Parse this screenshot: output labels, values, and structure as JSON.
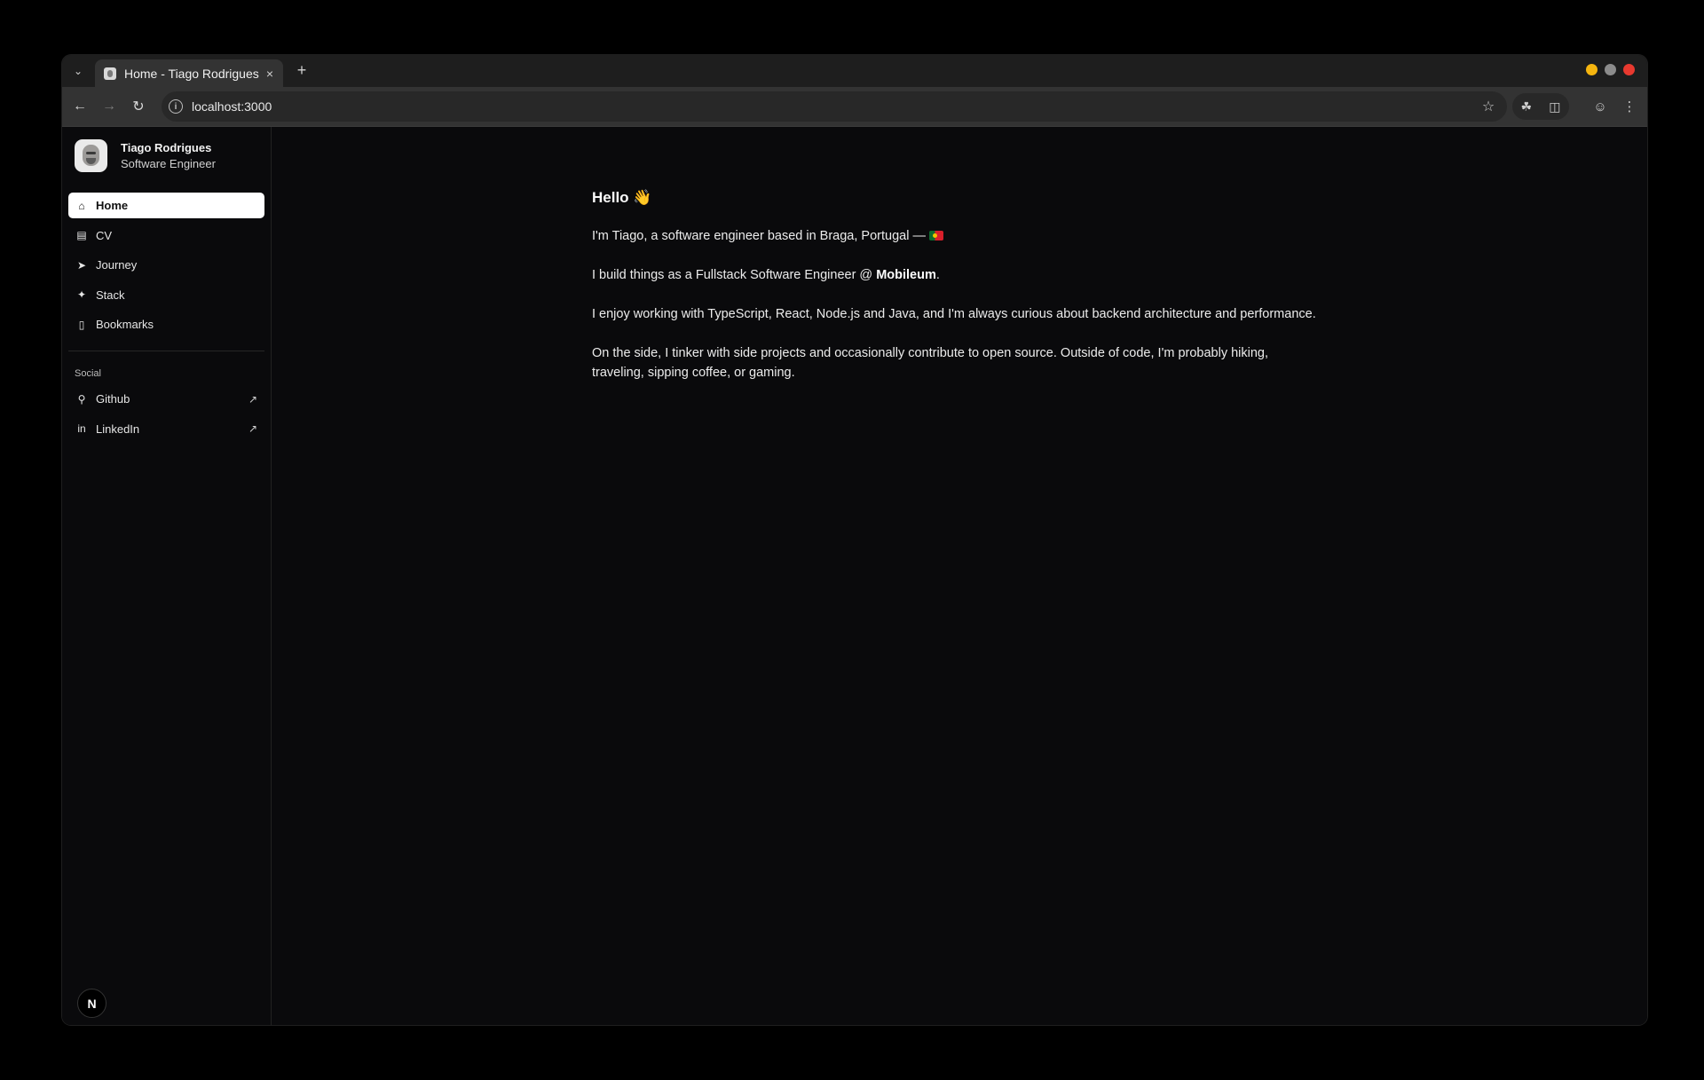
{
  "browser": {
    "tab_title": "Home - Tiago Rodrigues",
    "tab_close": "×",
    "new_tab": "+",
    "url": "localhost:3000",
    "traffic_colors": [
      "#f5b50f",
      "#8c8c8c",
      "#e8392f"
    ]
  },
  "sidebar": {
    "name": "Tiago Rodrigues",
    "role": "Software Engineer",
    "nav": [
      {
        "label": "Home",
        "icon": "home-icon",
        "active": true
      },
      {
        "label": "CV",
        "icon": "document-icon"
      },
      {
        "label": "Journey",
        "icon": "send-icon"
      },
      {
        "label": "Stack",
        "icon": "wand-icon"
      },
      {
        "label": "Bookmarks",
        "icon": "bookmark-icon"
      }
    ],
    "social_label": "Social",
    "social": [
      {
        "label": "Github",
        "icon": "github-icon"
      },
      {
        "label": "LinkedIn",
        "icon": "linkedin-icon"
      }
    ],
    "footer_badge": "N"
  },
  "main": {
    "heading": "Hello 👋",
    "p1": "I'm Tiago, a software engineer based in Braga, Portugal — ",
    "p2_prefix": "I build things as a Fullstack Software Engineer @ ",
    "p2_company": "Mobileum",
    "p2_suffix": ".",
    "p3": "I enjoy working with TypeScript, React, Node.js and Java, and I'm always curious about backend architecture and performance.",
    "p4": "On the side, I tinker with side projects and occasionally contribute to open source. Outside of code, I'm probably hiking, traveling, sipping coffee, or gaming."
  }
}
